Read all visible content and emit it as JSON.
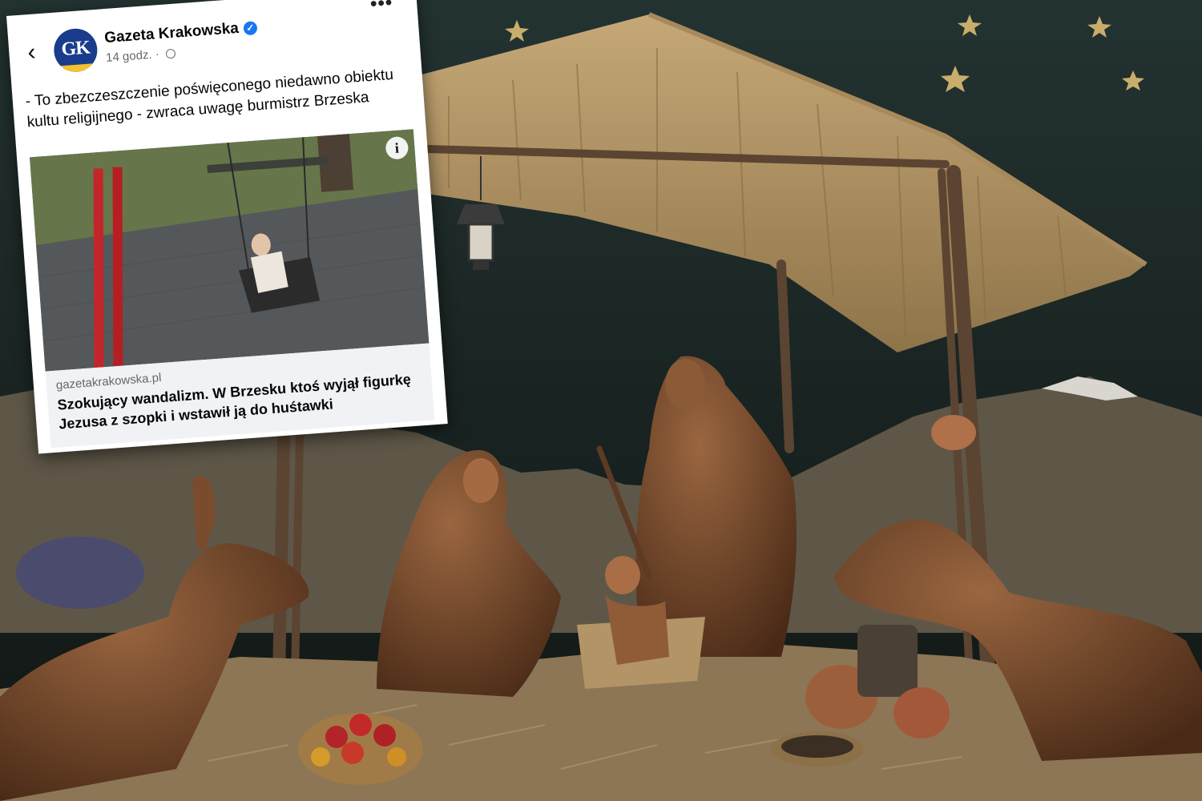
{
  "post": {
    "page_name": "Gazeta Krakowska",
    "logo_text": "GK",
    "time": "14 godz.",
    "separator": "·",
    "text": "- To zbezczeszczenie poświęconego niedawno obiektu kultu religijnego - zwraca uwagę burmistrz Brzeska",
    "link_domain": "gazetakrakowska.pl",
    "link_title": "Szokujący wandalizm. W Brzesku ktoś wyjął figurkę Jezusa z szopki i wstawił ją do huśtawki"
  },
  "icons": {
    "back": "‹",
    "verified": "✓",
    "more": "•••",
    "info": "i"
  },
  "colors": {
    "brand_blue": "#1a3c8c",
    "brand_yellow": "#f2c230",
    "verified_blue": "#1877f2",
    "swing_red": "#c3262a"
  }
}
